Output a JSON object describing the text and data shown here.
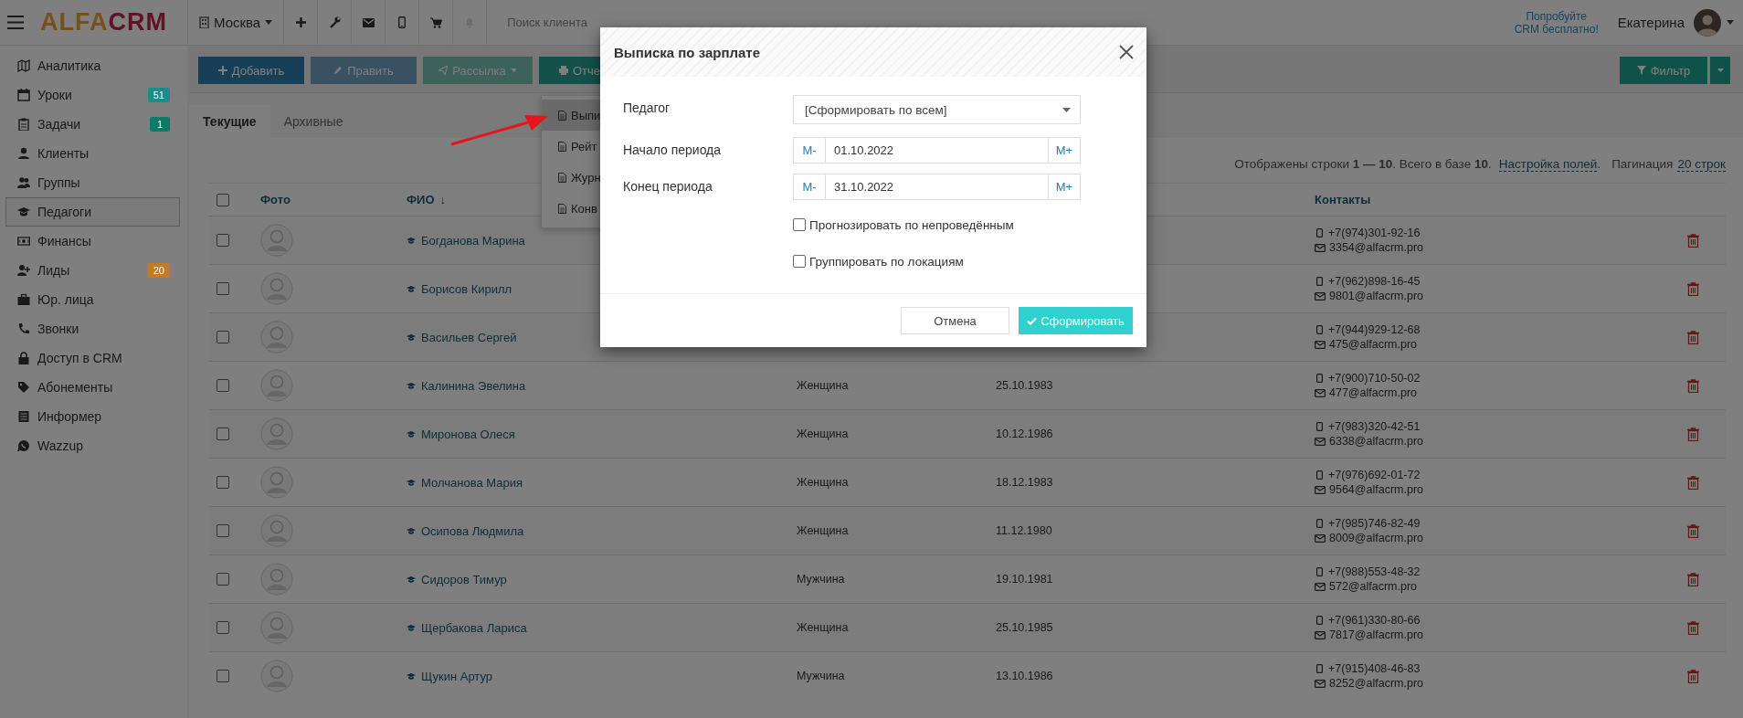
{
  "topbar": {
    "logo": [
      "ALFA",
      "CRM"
    ],
    "city": "Москва",
    "search": {
      "placeholder": "Поиск клиента"
    },
    "promo": "Попробуйте CRM бесплатно!",
    "user": "Екатерина"
  },
  "sidebar": {
    "items": [
      {
        "label": "Аналитика",
        "selected": false
      },
      {
        "label": "Уроки",
        "selected": false,
        "badge": "51",
        "color": "#1b8b8b"
      },
      {
        "label": "Задачи",
        "selected": false,
        "badge": "1",
        "color": "#0e7b69"
      },
      {
        "label": "Клиенты",
        "selected": false
      },
      {
        "label": "Группы",
        "selected": false
      },
      {
        "label": "Педагоги",
        "selected": true
      },
      {
        "label": "Финансы",
        "selected": false
      },
      {
        "label": "Лиды",
        "selected": false,
        "badge": "20",
        "color": "#c47a26"
      },
      {
        "label": "Юр. лица",
        "selected": false
      },
      {
        "label": "Звонки",
        "selected": false
      },
      {
        "label": "Доступ в CRM",
        "selected": false
      },
      {
        "label": "Абонементы",
        "selected": false
      },
      {
        "label": "Информер",
        "selected": false
      },
      {
        "label": "Wazzup",
        "selected": false
      }
    ]
  },
  "toolbar": {
    "buttons": [
      {
        "label": "Добавить",
        "kind": "primary",
        "disabled": false,
        "dropdown": false
      },
      {
        "label": "Править",
        "kind": "primary",
        "disabled": true,
        "dropdown": false
      },
      {
        "label": "Рассылка",
        "kind": "success",
        "disabled": true,
        "dropdown": true
      },
      {
        "label": "Отче",
        "kind": "info",
        "disabled": false,
        "dropdown": false
      }
    ],
    "filter": {
      "label": "Фильтр"
    }
  },
  "reports_menu": {
    "items": [
      {
        "label": "Выпи",
        "highlighted": true
      },
      {
        "label": "Рейт",
        "highlighted": false
      },
      {
        "label": "Журн",
        "highlighted": false
      },
      {
        "label": "Конв",
        "highlighted": false
      }
    ]
  },
  "tabs": [
    {
      "label": "Текущие",
      "selected": true
    },
    {
      "label": "Архивные",
      "selected": false
    }
  ],
  "info": {
    "summary": "Отображены строки **1 — 10**. Всего в базе **10**.",
    "fields_link": "Настройка полей",
    "separator": ".",
    "pagination_label": "Пагинация",
    "pagination_link": "20 строк"
  },
  "table": {
    "select_all": {
      "checked": false
    },
    "columns": {
      "photo": "Фото",
      "name": "ФИО",
      "sort_mark": "↓",
      "contacts": "Контакты"
    },
    "rows": [
      {
        "checked": false,
        "name": "Богданова Марина",
        "phone": "+7(974)301-92-16",
        "email": "3354@alfacrm.pro"
      },
      {
        "checked": false,
        "name": "Борисов Кирилл",
        "phone": "+7(962)898-16-45",
        "email": "9801@alfacrm.pro"
      },
      {
        "checked": false,
        "name": "Васильев Сергей",
        "phone": "+7(944)929-12-68",
        "email": "475@alfacrm.pro"
      },
      {
        "checked": false,
        "name": "Калинина Эвелина",
        "gender": "Женщина",
        "birth_date": "25.10.1983",
        "phone": "+7(900)710-50-02",
        "email": "477@alfacrm.pro"
      },
      {
        "checked": false,
        "name": "Миронова Олеся",
        "gender": "Женщина",
        "birth_date": "10.12.1986",
        "phone": "+7(983)320-42-51",
        "email": "6338@alfacrm.pro"
      },
      {
        "checked": false,
        "name": "Молчанова Мария",
        "gender": "Женщина",
        "birth_date": "18.12.1983",
        "phone": "+7(976)692-01-72",
        "email": "9564@alfacrm.pro"
      },
      {
        "checked": false,
        "name": "Осипова Людмила",
        "gender": "Женщина",
        "birth_date": "11.12.1980",
        "phone": "+7(985)746-82-49",
        "email": "8009@alfacrm.pro"
      },
      {
        "checked": false,
        "name": "Сидоров Тимур",
        "gender": "Мужчина",
        "birth_date": "19.10.1981",
        "phone": "+7(988)553-48-32",
        "email": "572@alfacrm.pro"
      },
      {
        "checked": false,
        "name": "Щербакова Лариса",
        "gender": "Женщина",
        "birth_date": "25.10.1985",
        "phone": "+7(961)330-80-66",
        "email": "7817@alfacrm.pro"
      },
      {
        "checked": false,
        "name": "Щукин Артур",
        "gender": "Мужчина",
        "birth_date": "13.10.1986",
        "phone": "+7(915)408-46-83",
        "email": "8252@alfacrm.pro"
      }
    ]
  },
  "modal": {
    "title": "Выписка по зарплате",
    "teacher": {
      "label": "Педагог",
      "value": "[Сформировать по всем]"
    },
    "periods": [
      {
        "label": "Начало периода",
        "minus": "M-",
        "value": "01.10.2022",
        "plus": "M+"
      },
      {
        "label": "Конец периода",
        "minus": "M-",
        "value": "31.10.2022",
        "plus": "M+"
      }
    ],
    "options": [
      {
        "label": "Прогнозировать по непроведённым",
        "checked": false
      },
      {
        "label": "Группировать по локациям",
        "checked": false
      }
    ],
    "cancel": "Отмена",
    "submit": "Сформировать"
  }
}
